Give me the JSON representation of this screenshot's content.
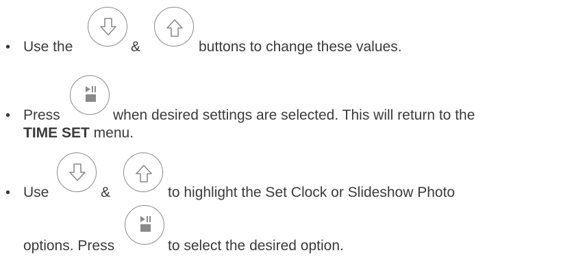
{
  "bullet_char": "•",
  "line1": {
    "prefix": "Use the",
    "amp": "&",
    "suffix": "buttons to change these values."
  },
  "line2": {
    "prefix": "Press",
    "suffix": "when desired settings are selected. This will return to the",
    "bold": "TIME SET",
    "tail": " menu."
  },
  "line3": {
    "prefix": "Use",
    "amp": "&",
    "suffix": "to highlight the Set Clock or Slideshow Photo",
    "cont_prefix": "options.  Press",
    "cont_suffix": "to select the desired option."
  },
  "icons": {
    "down": "down-arrow-icon",
    "up": "up-arrow-icon",
    "play_pause": "play-pause-stop-icon"
  }
}
